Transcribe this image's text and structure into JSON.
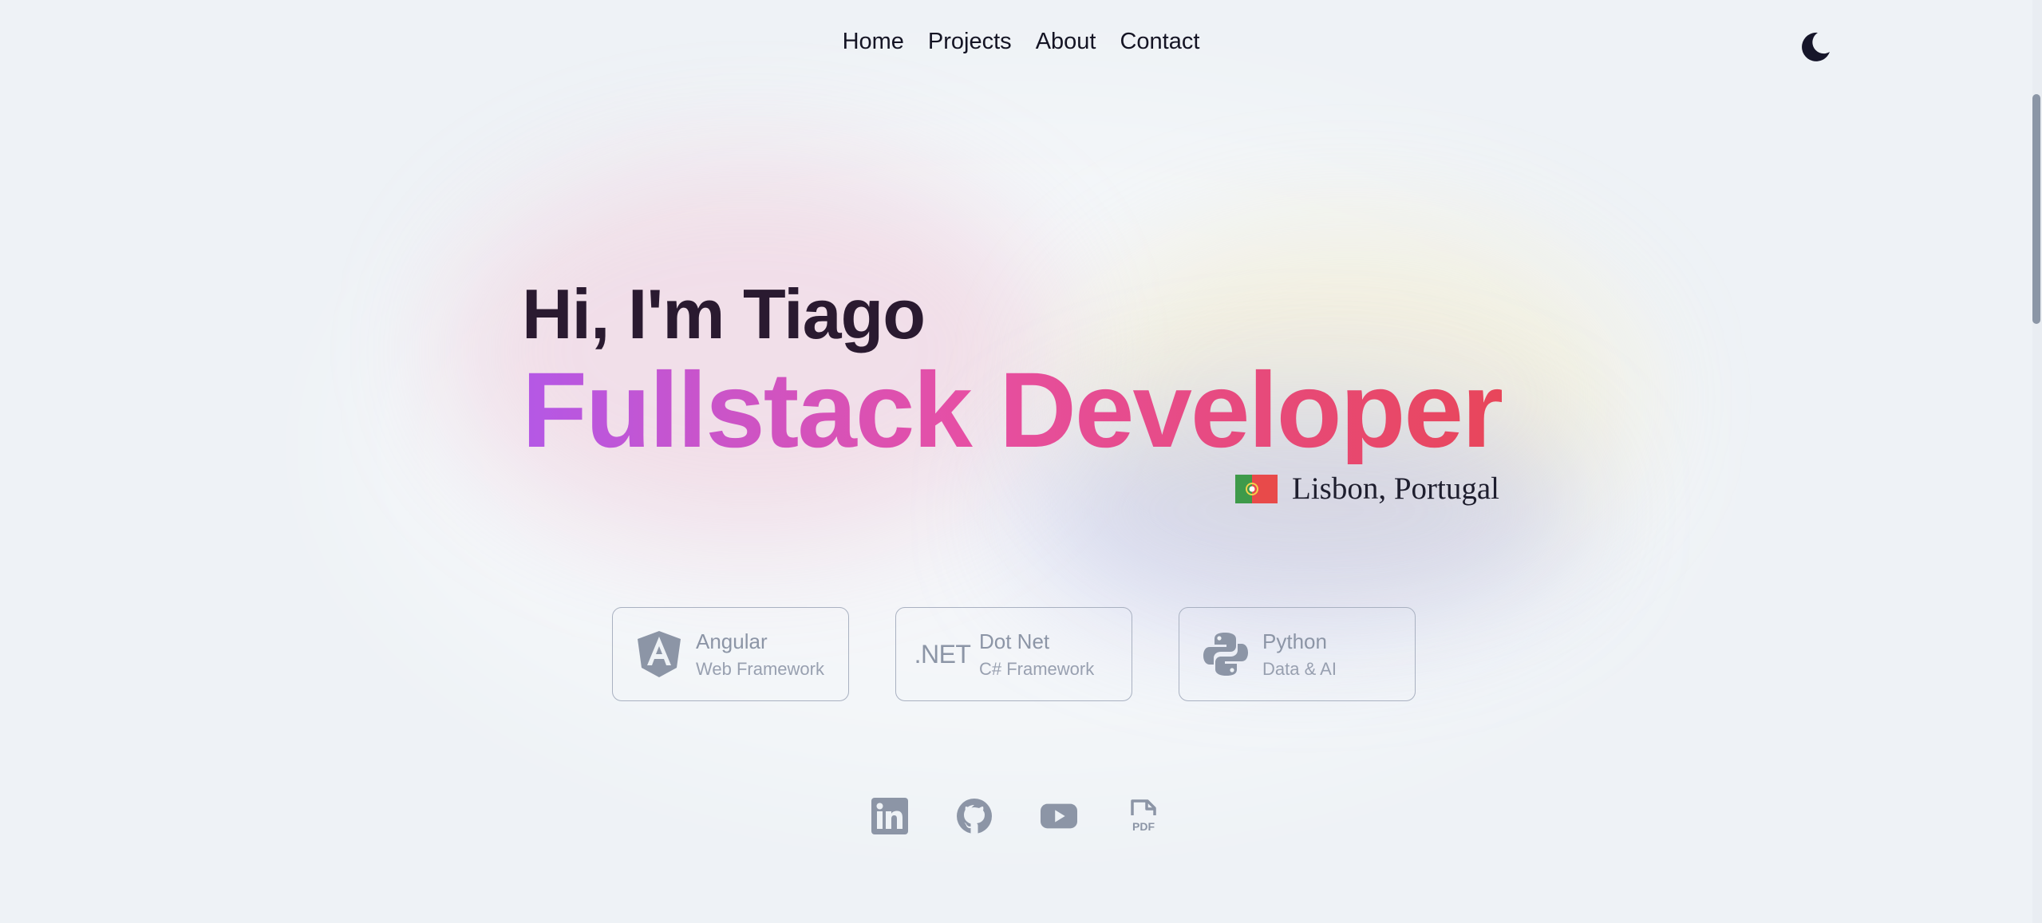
{
  "nav": {
    "items": [
      {
        "label": "Home"
      },
      {
        "label": "Projects"
      },
      {
        "label": "About"
      },
      {
        "label": "Contact"
      }
    ],
    "theme_toggle_icon": "moon-icon"
  },
  "hero": {
    "greeting": "Hi, I'm Tiago",
    "role": "Fullstack Developer",
    "gradient_colors": [
      "#b458e6",
      "#e64fa4",
      "#e8465a"
    ]
  },
  "location": {
    "text": "Lisbon, Portugal",
    "flag_icon": "portugal-flag-icon"
  },
  "skills": [
    {
      "icon": "angular-icon",
      "title": "Angular",
      "subtitle": "Web Framework"
    },
    {
      "icon": "dotnet-icon",
      "icon_text": ".NET",
      "title": "Dot Net",
      "subtitle": "C# Framework"
    },
    {
      "icon": "python-icon",
      "title": "Python",
      "subtitle": "Data & AI"
    }
  ],
  "socials": [
    {
      "icon": "linkedin-icon"
    },
    {
      "icon": "github-icon"
    },
    {
      "icon": "youtube-icon"
    },
    {
      "icon": "pdf-icon",
      "label": "PDF"
    }
  ],
  "colors": {
    "background": "#eef2f6",
    "icon_gray": "#8c95a6",
    "text_dark": "#141424"
  }
}
